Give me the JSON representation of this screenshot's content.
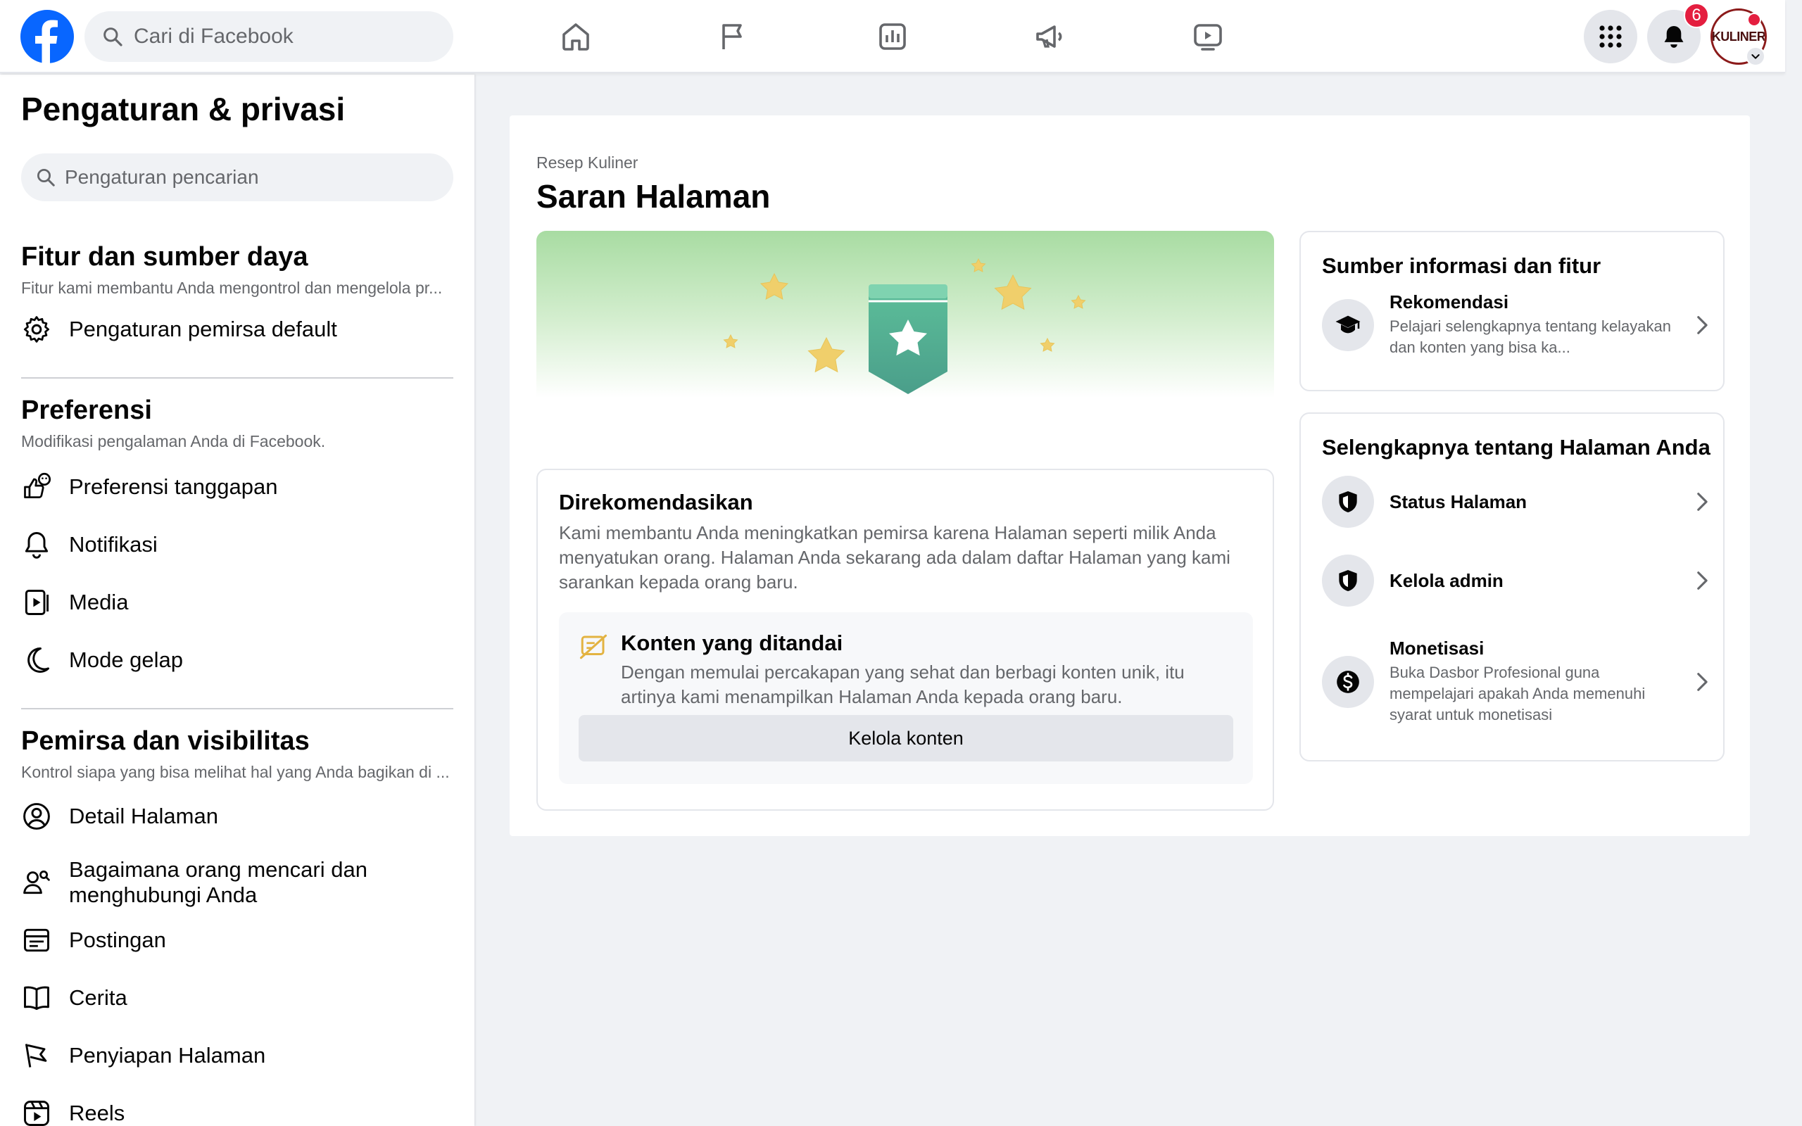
{
  "topbar": {
    "search_placeholder": "Cari di Facebook",
    "notification_count": "6",
    "avatar_text": "KULINER"
  },
  "sidebar": {
    "title": "Pengaturan & privasi",
    "search_placeholder": "Pengaturan pencarian",
    "sections": [
      {
        "heading": "Fitur dan sumber daya",
        "subtitle": "Fitur kami membantu Anda mengontrol dan mengelola pr...",
        "items": [
          {
            "label": "Pengaturan pemirsa default",
            "icon": "gear-icon"
          }
        ]
      },
      {
        "heading": "Preferensi",
        "subtitle": "Modifikasi pengalaman Anda di Facebook.",
        "items": [
          {
            "label": "Preferensi tanggapan",
            "icon": "reaction-icon"
          },
          {
            "label": "Notifikasi",
            "icon": "bell-icon"
          },
          {
            "label": "Media",
            "icon": "media-icon"
          },
          {
            "label": "Mode gelap",
            "icon": "moon-icon"
          }
        ]
      },
      {
        "heading": "Pemirsa dan visibilitas",
        "subtitle": "Kontrol siapa yang bisa melihat hal yang Anda bagikan di ...",
        "items": [
          {
            "label": "Detail Halaman",
            "icon": "user-circle-icon"
          },
          {
            "label": "Bagaimana orang mencari dan menghubungi Anda",
            "icon": "people-search-icon"
          },
          {
            "label": "Postingan",
            "icon": "post-icon"
          },
          {
            "label": "Cerita",
            "icon": "book-icon"
          },
          {
            "label": "Penyiapan Halaman",
            "icon": "flag-icon"
          },
          {
            "label": "Reels",
            "icon": "reels-icon"
          }
        ]
      }
    ]
  },
  "main": {
    "breadcrumb": "Resep Kuliner",
    "title": "Saran Halaman",
    "recommended": {
      "heading": "Direkomendasikan",
      "text": "Kami membantu Anda meningkatkan pemirsa karena Halaman seperti milik Anda menyatukan orang. Halaman Anda sekarang ada dalam daftar Halaman yang kami sarankan kepada orang baru.",
      "flagged": {
        "heading": "Konten yang ditandai",
        "text": "Dengan memulai percakapan yang sehat dan berbagi konten unik, itu artinya kami menampilkan Halaman Anda kepada orang baru.",
        "button": "Kelola konten"
      }
    },
    "resources": {
      "heading": "Sumber informasi dan fitur",
      "items": [
        {
          "title": "Rekomendasi",
          "desc": "Pelajari selengkapnya tentang kelayakan dan konten yang bisa ka...",
          "icon": "graduation-cap-icon"
        }
      ]
    },
    "more": {
      "heading": "Selengkapnya tentang Halaman Anda",
      "items": [
        {
          "title": "Status Halaman",
          "desc": "",
          "icon": "shield-icon"
        },
        {
          "title": "Kelola admin",
          "desc": "",
          "icon": "shield-icon"
        },
        {
          "title": "Monetisasi",
          "desc": "Buka Dasbor Profesional guna mempelajari apakah Anda memenuhi syarat untuk monetisasi",
          "icon": "dollar-icon"
        }
      ]
    }
  },
  "colors": {
    "brand": "#0866ff",
    "badge": "#e41e3f",
    "star": "#f0cf6b",
    "ribbon": "#4faa8f"
  }
}
